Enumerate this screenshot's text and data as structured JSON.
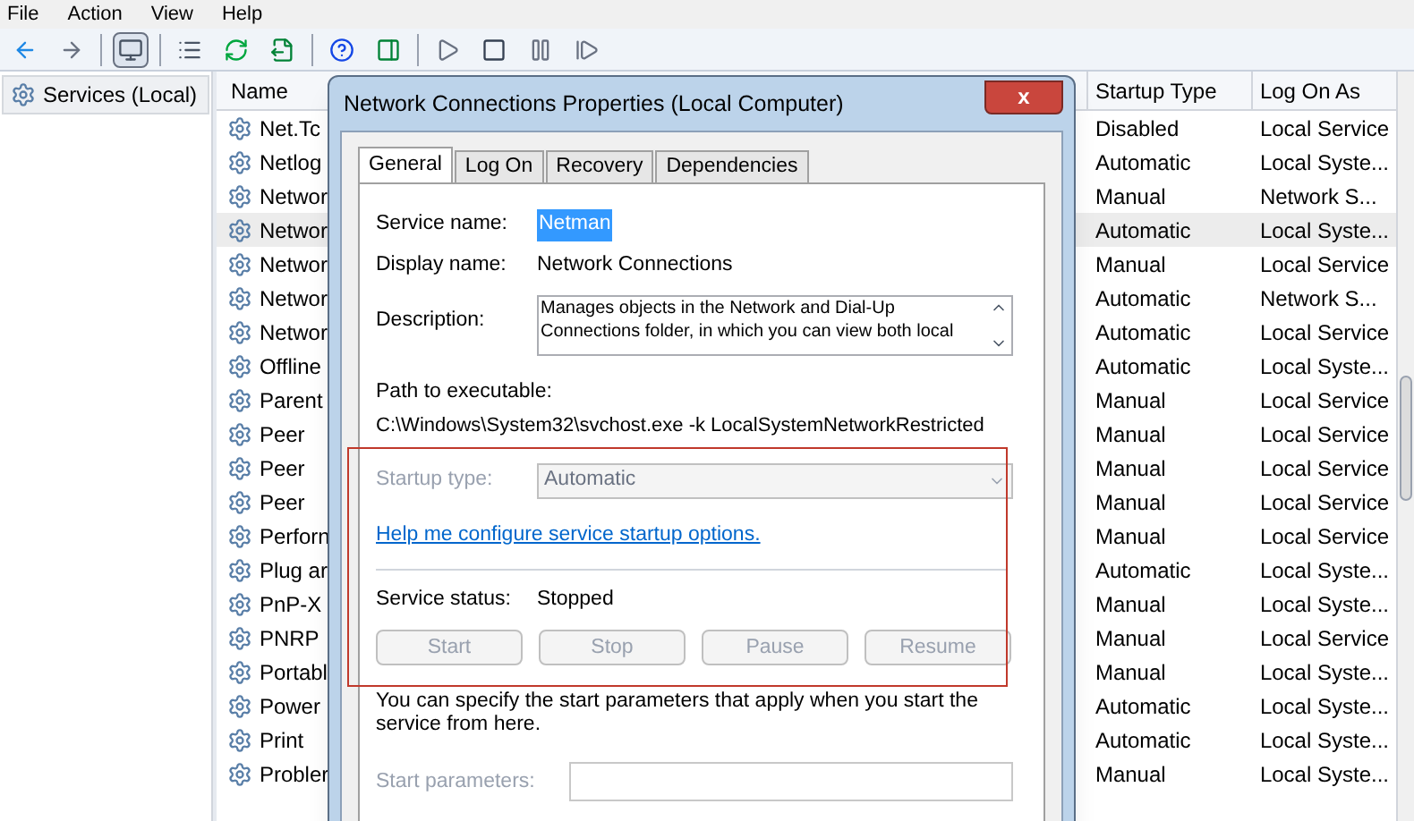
{
  "menu": [
    "File",
    "Action",
    "View",
    "Help"
  ],
  "toolbar": [
    {
      "kind": "back"
    },
    {
      "kind": "forward"
    },
    {
      "kind": "sep"
    },
    {
      "kind": "console",
      "selected": true
    },
    {
      "kind": "sep"
    },
    {
      "kind": "list"
    },
    {
      "kind": "refresh"
    },
    {
      "kind": "export"
    },
    {
      "kind": "sep"
    },
    {
      "kind": "help"
    },
    {
      "kind": "pane"
    },
    {
      "kind": "sep"
    },
    {
      "kind": "play"
    },
    {
      "kind": "stop"
    },
    {
      "kind": "pause"
    },
    {
      "kind": "resume"
    }
  ],
  "tree": {
    "label": "Services (Local)",
    "selected": true
  },
  "table": {
    "columns": [
      "Name",
      "Startup Type",
      "Log On As"
    ],
    "rows": [
      {
        "name": "Net.Tc",
        "startup": "Disabled",
        "logon": "Local Service",
        "selected": false
      },
      {
        "name": "Netlog",
        "startup": "Automatic",
        "logon": "Local Syste...",
        "selected": false
      },
      {
        "name": "Networ",
        "startup": "Manual",
        "logon": "Network S...",
        "selected": false
      },
      {
        "name": "Networ",
        "startup": "Automatic",
        "logon": "Local Syste...",
        "selected": true
      },
      {
        "name": "Networ",
        "startup": "Manual",
        "logon": "Local Service",
        "selected": false
      },
      {
        "name": "Networ",
        "startup": "Automatic",
        "logon": "Network S...",
        "selected": false
      },
      {
        "name": "Networ",
        "startup": "Automatic",
        "logon": "Local Service",
        "selected": false
      },
      {
        "name": "Offline",
        "startup": "Automatic",
        "logon": "Local Syste...",
        "selected": false
      },
      {
        "name": "Parent",
        "startup": "Manual",
        "logon": "Local Service",
        "selected": false
      },
      {
        "name": "Peer",
        "startup": "Manual",
        "logon": "Local Service",
        "selected": false
      },
      {
        "name": "Peer",
        "startup": "Manual",
        "logon": "Local Service",
        "selected": false
      },
      {
        "name": "Peer",
        "startup": "Manual",
        "logon": "Local Service",
        "selected": false
      },
      {
        "name": "Perforn",
        "startup": "Manual",
        "logon": "Local Service",
        "selected": false
      },
      {
        "name": "Plug ar",
        "startup": "Automatic",
        "logon": "Local Syste...",
        "selected": false
      },
      {
        "name": "PnP-X",
        "startup": "Manual",
        "logon": "Local Syste...",
        "selected": false
      },
      {
        "name": "PNRP",
        "startup": "Manual",
        "logon": "Local Service",
        "selected": false
      },
      {
        "name": "Portabl",
        "startup": "Manual",
        "logon": "Local Syste...",
        "selected": false
      },
      {
        "name": "Power",
        "startup": "Automatic",
        "logon": "Local Syste...",
        "selected": false
      },
      {
        "name": "Print",
        "startup": "Automatic",
        "logon": "Local Syste...",
        "selected": false
      },
      {
        "name": "Probler",
        "startup": "Manual",
        "logon": "Local Syste...",
        "selected": false
      }
    ]
  },
  "dialog": {
    "title": "Network Connections Properties (Local Computer)",
    "close": "x",
    "tabs": [
      {
        "label": "General",
        "selected": true
      },
      {
        "label": "Log On",
        "selected": false
      },
      {
        "label": "Recovery",
        "selected": false
      },
      {
        "label": "Dependencies",
        "selected": false
      }
    ],
    "service_name": {
      "label": "Service name:",
      "value": "Netman",
      "highlighted": true
    },
    "display_name": {
      "label": "Display name:",
      "value": "Network Connections"
    },
    "description": {
      "label": "Description:",
      "value": "Manages objects in the Network and Dial-Up Connections folder, in which you can view both local"
    },
    "path": {
      "label": "Path to executable:",
      "value": "C:\\Windows\\System32\\svchost.exe -k LocalSystemNetworkRestricted"
    },
    "startup_type": {
      "label": "Startup type:",
      "value": "Automatic",
      "disabled": true
    },
    "help_link": "Help me configure service startup options.",
    "service_status": {
      "label": "Service status:",
      "value": "Stopped"
    },
    "buttons": [
      {
        "label": "Start",
        "disabled": true
      },
      {
        "label": "Stop",
        "disabled": true
      },
      {
        "label": "Pause",
        "disabled": true
      },
      {
        "label": "Resume",
        "disabled": true
      }
    ],
    "note": "You can specify the start parameters that apply when you start the service from here.",
    "start_parameters": {
      "label": "Start parameters:",
      "disabled": true
    }
  }
}
